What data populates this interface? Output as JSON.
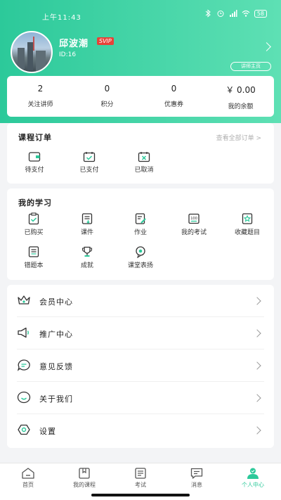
{
  "status_bar": {
    "time": "上午11:43",
    "battery": "58"
  },
  "profile": {
    "name": "邱波潮",
    "badge": "SVIP",
    "id_text": "ID:16",
    "lecturer_home_label": "讲师主页"
  },
  "stats": [
    {
      "value": "2",
      "label": "关注讲师"
    },
    {
      "value": "0",
      "label": "积分"
    },
    {
      "value": "0",
      "label": "优惠券"
    },
    {
      "value": "￥ 0.00",
      "label": "我的余额"
    }
  ],
  "orders": {
    "title": "课程订单",
    "view_all": "查看全部订单 >",
    "items": [
      {
        "label": "待支付",
        "icon": "wallet-icon"
      },
      {
        "label": "已支付",
        "icon": "calendar-check-icon"
      },
      {
        "label": "已取消",
        "icon": "calendar-cancel-icon"
      }
    ]
  },
  "study": {
    "title": "我的学习",
    "items": [
      {
        "label": "已购买",
        "icon": "clipboard-check-icon"
      },
      {
        "label": "课件",
        "icon": "courseware-icon"
      },
      {
        "label": "作业",
        "icon": "homework-icon"
      },
      {
        "label": "我的考试",
        "icon": "exam-100-icon"
      },
      {
        "label": "收藏题目",
        "icon": "favorite-question-icon"
      },
      {
        "label": "错题本",
        "icon": "wrong-book-icon"
      },
      {
        "label": "成就",
        "icon": "trophy-icon"
      },
      {
        "label": "课堂表扬",
        "icon": "praise-icon"
      }
    ]
  },
  "menu": [
    {
      "label": "会员中心",
      "icon": "crown-icon"
    },
    {
      "label": "推广中心",
      "icon": "megaphone-icon"
    },
    {
      "label": "意见反馈",
      "icon": "feedback-icon"
    },
    {
      "label": "关于我们",
      "icon": "smile-icon"
    },
    {
      "label": "设置",
      "icon": "settings-icon"
    }
  ],
  "tabs": [
    {
      "label": "首页",
      "icon": "home-icon"
    },
    {
      "label": "我的课程",
      "icon": "course-icon"
    },
    {
      "label": "考试",
      "icon": "exam-icon"
    },
    {
      "label": "消息",
      "icon": "message-icon"
    },
    {
      "label": "个人中心",
      "icon": "person-icon",
      "active": true
    }
  ],
  "colors": {
    "accent": "#2cc99a",
    "svip": "#e64238"
  }
}
